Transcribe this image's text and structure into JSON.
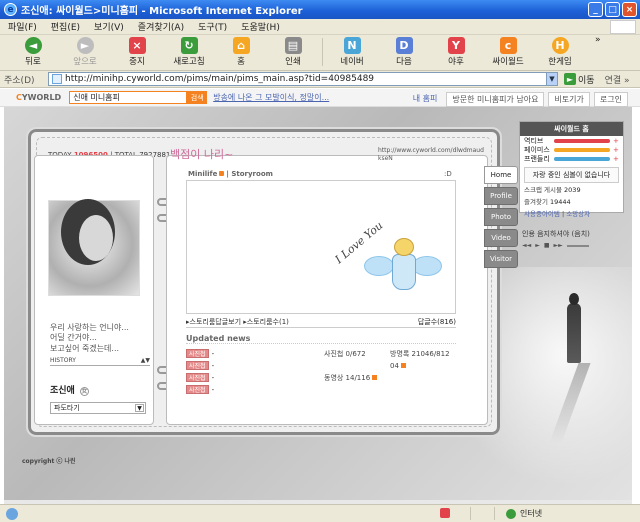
{
  "window": {
    "title": "조신애: 싸이월드>미니홈피 - Microsoft Internet Explorer",
    "buttons": [
      "_",
      "□",
      "×"
    ]
  },
  "menu": [
    "파일(F)",
    "편집(E)",
    "보기(V)",
    "즐겨찾기(A)",
    "도구(T)",
    "도움말(H)"
  ],
  "toolbar": {
    "back": "뒤로",
    "forward": "앞으로",
    "stop": "중지",
    "refresh": "새로고침",
    "home": "홈",
    "print": "인쇄",
    "naver": "네이버",
    "daum": "다음",
    "yahoo": "야후",
    "cyworld": "싸이월드",
    "hangame": "한게임",
    "more": "»"
  },
  "address": {
    "label": "주소(D)",
    "url": "http://minihp.cyworld.com/pims/main/pims_main.asp?tid=40985489",
    "go": "이동",
    "links": "연결 »"
  },
  "cyworld_bar": {
    "logo_prefix": "C",
    "logo": "YWORLD",
    "search_value": "신애 미니홈피",
    "search_button": "검색",
    "notice": "방송에 나온 그 모발이식, 정말이...",
    "links": [
      "내 홈피",
      "방문한 미니홈피가 남아요",
      "비토기가",
      "로그인"
    ]
  },
  "counter": {
    "today_label": "TODAY",
    "today": "1096500",
    "sep": "|",
    "total_label": "TOTAL",
    "total": "7927881"
  },
  "homepage": {
    "title": "백점이 나리~",
    "url": "http://www.cyworld.com/dlwdmaud\nkseN"
  },
  "profile": {
    "intro": "우리 사랑하는 언니야...\n어딜 간거야...\n보고싶어 죽겠는데...",
    "history": "HISTORY",
    "history_arrows": "▲▼",
    "owner": "조신애",
    "owner_gender": "女",
    "wave": "파도타기",
    "wave_drop": "▼"
  },
  "minilife": {
    "label": "Minilife",
    "sep": "|",
    "storyroom": "Storyroom",
    "emoticon": ":D",
    "love": "I Love You",
    "link1": "스토리룸답글보기",
    "link2": "스토리룸수(1)",
    "comments": "답글수(816)"
  },
  "updated": {
    "title": "Updated news",
    "items": [
      {
        "tag": "사진첩",
        "text": "-"
      },
      {
        "tag": "사진첩",
        "text": "-"
      },
      {
        "tag": "사진첩",
        "text": "-"
      },
      {
        "tag": "사진첩",
        "text": "-"
      }
    ]
  },
  "stats": {
    "photos": "사진첩 0/672",
    "guestbook": "방명록 21046/812",
    "guestbook2": "04",
    "videos": "동영상 14/116"
  },
  "tabs": [
    "Home",
    "Profile",
    "Photo",
    "Video",
    "Visitor"
  ],
  "right": {
    "title": "싸이월드 홈",
    "bars": [
      {
        "name": "역티브",
        "color": "#e2434a"
      },
      {
        "name": "페이미스",
        "color": "#f5a623"
      },
      {
        "name": "프랜들리",
        "color": "#4aa6d6"
      }
    ],
    "plus": "+",
    "empty": "자랑 중인 심볼이 없습니다",
    "scrap": "스크랩 게시물",
    "scrap_n": "2039",
    "fav": "즐겨찾기",
    "fav_n": "19444",
    "gift": "사용중아이템",
    "gift2": "소망상자",
    "bgm": "인용 음지하셔야 (음치)",
    "bgm_ctl": [
      "◄◄",
      "►",
      "■",
      "►►"
    ]
  },
  "copyright": "copyright ⓒ 나린",
  "status": {
    "zone": "인터넷"
  }
}
